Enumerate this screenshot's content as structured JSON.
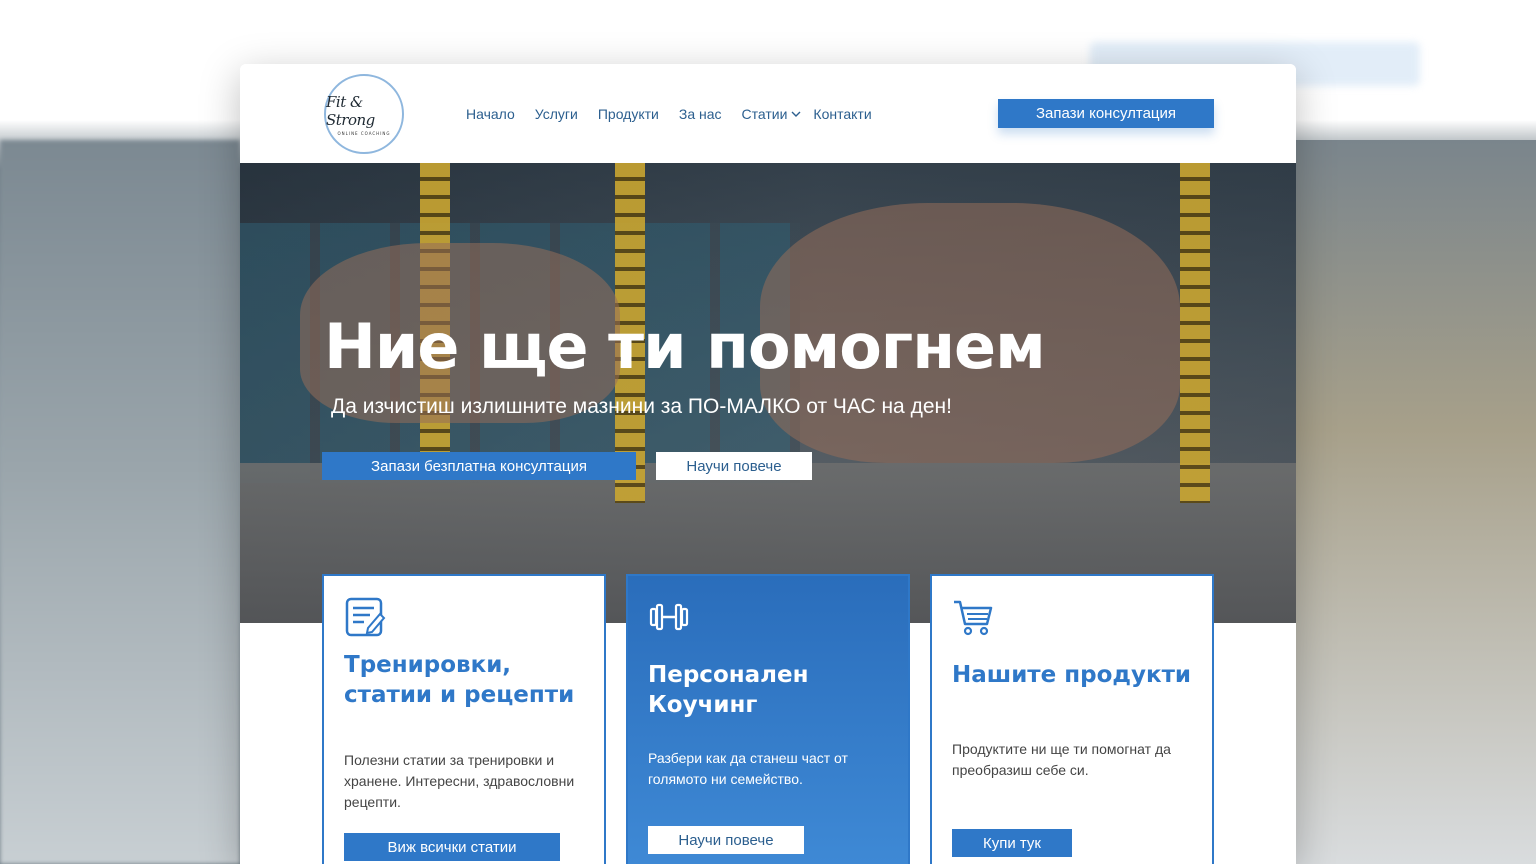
{
  "header": {
    "logo_text": "Fit & Strong",
    "logo_sub": "ONLINE COACHING",
    "nav": [
      {
        "label": "Начало"
      },
      {
        "label": "Услуги"
      },
      {
        "label": "Продукти"
      },
      {
        "label": "За нас"
      },
      {
        "label": "Статии"
      },
      {
        "label": "Контакти"
      }
    ],
    "cta_label": "Запази консултация"
  },
  "hero": {
    "title": "Ние ще ти помогнем",
    "subtitle": "Да изчистиш излишните мазнини за ПО-МАЛКО от ЧАС на ден!",
    "primary_button": "Запази безплатна консултация",
    "secondary_button": "Научи повече"
  },
  "cards": [
    {
      "icon": "notepad-icon",
      "title": "Тренировки, статии и рецепти",
      "text": "Полезни статии за тренировки и хранене. Интересни, здравословни рецепти.",
      "button": "Виж всички статии"
    },
    {
      "icon": "dumbbell-icon",
      "title": "Персонален Коучинг",
      "text": "Разбери как да станеш част от голямото ни семейство.",
      "button": "Научи повече"
    },
    {
      "icon": "cart-icon",
      "title": "Нашите продукти",
      "text": "Продуктите ни ще ти помогнат да преобразиш себе си.",
      "button": "Купи тук"
    }
  ],
  "colors": {
    "accent": "#2f78c8",
    "nav_text": "#2c5f8f",
    "white": "#ffffff"
  }
}
